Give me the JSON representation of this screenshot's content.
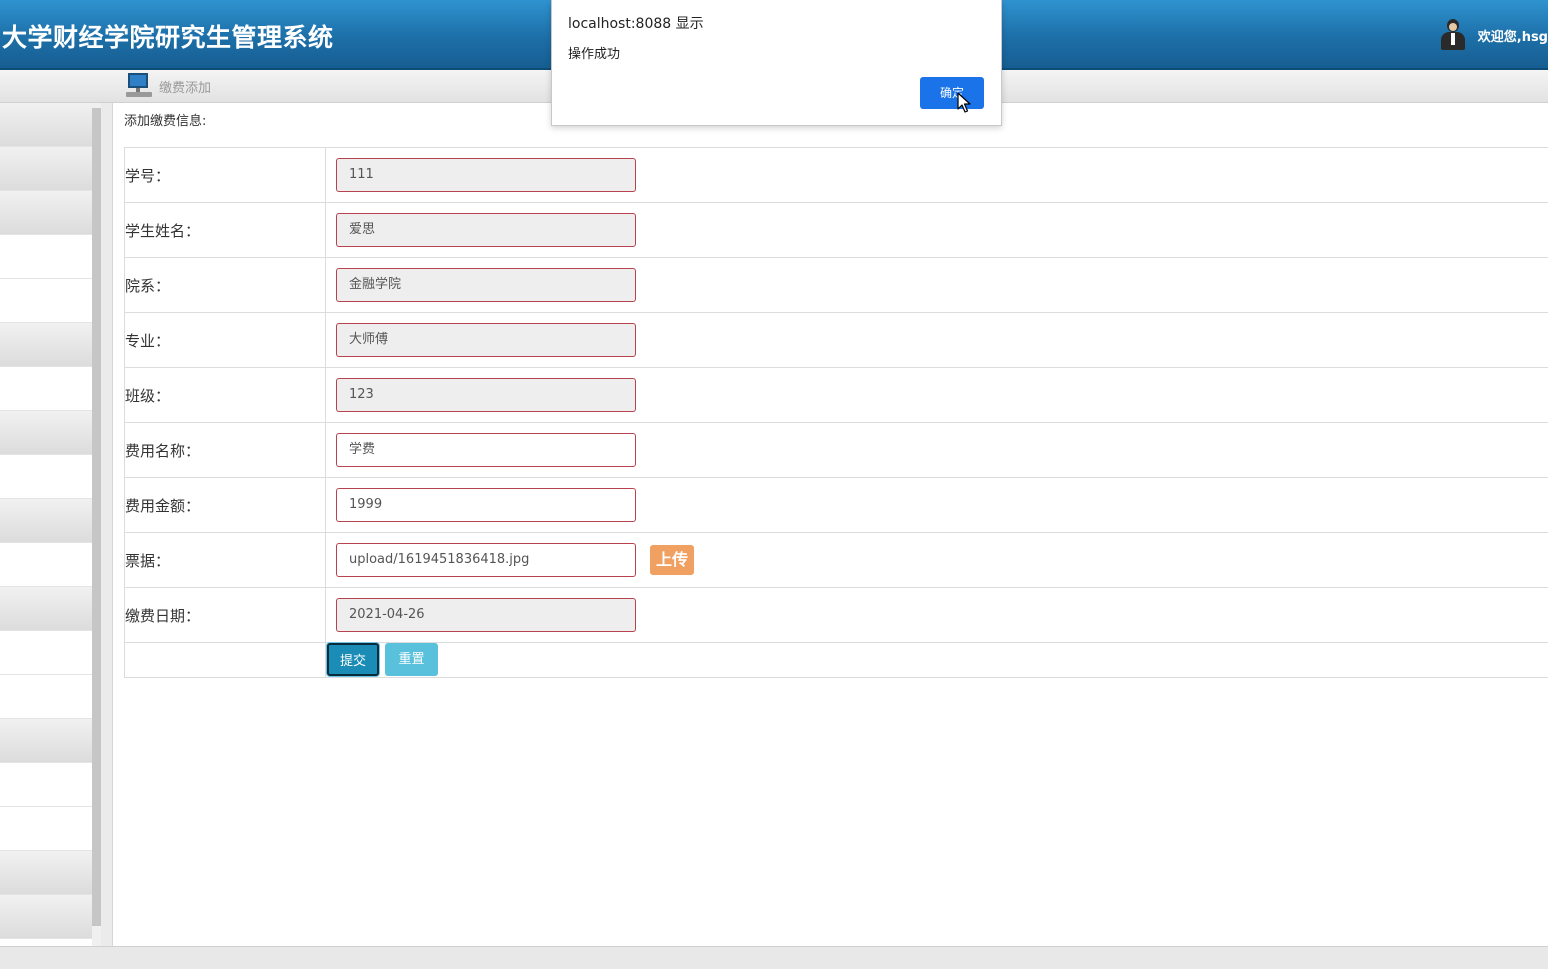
{
  "header": {
    "title": "大学财经学院研究生管理系统",
    "welcome": "欢迎您,hsg"
  },
  "toolbar": {
    "icon": "computer-icon",
    "breadcrumb": "缴费添加"
  },
  "main": {
    "section_title": "添加缴费信息:",
    "fields": [
      {
        "label": "学号：",
        "value": "111",
        "editable": false
      },
      {
        "label": "学生姓名：",
        "value": "爱思",
        "editable": false
      },
      {
        "label": "院系：",
        "value": "金融学院",
        "editable": false
      },
      {
        "label": "专业：",
        "value": "大师傅",
        "editable": false
      },
      {
        "label": "班级：",
        "value": "123",
        "editable": false
      },
      {
        "label": "费用名称：",
        "value": "学费",
        "editable": true
      },
      {
        "label": "费用金额：",
        "value": "1999",
        "editable": true
      },
      {
        "label": "票据：",
        "value": "upload/1619451836418.jpg",
        "editable": true
      },
      {
        "label": "缴费日期：",
        "value": "2021-04-26",
        "editable": false
      }
    ],
    "upload_label": "上传",
    "submit_label": "提交",
    "reset_label": "重置"
  },
  "dialog": {
    "title": "localhost:8088 显示",
    "message": "操作成功",
    "ok_label": "确定"
  },
  "colors": {
    "header": "#1d6fa8",
    "input_border": "#b8434f",
    "upload": "#f0a060",
    "submit": "#1a8cb5",
    "reset": "#59c1db",
    "dialog_ok": "#1a73e8"
  }
}
